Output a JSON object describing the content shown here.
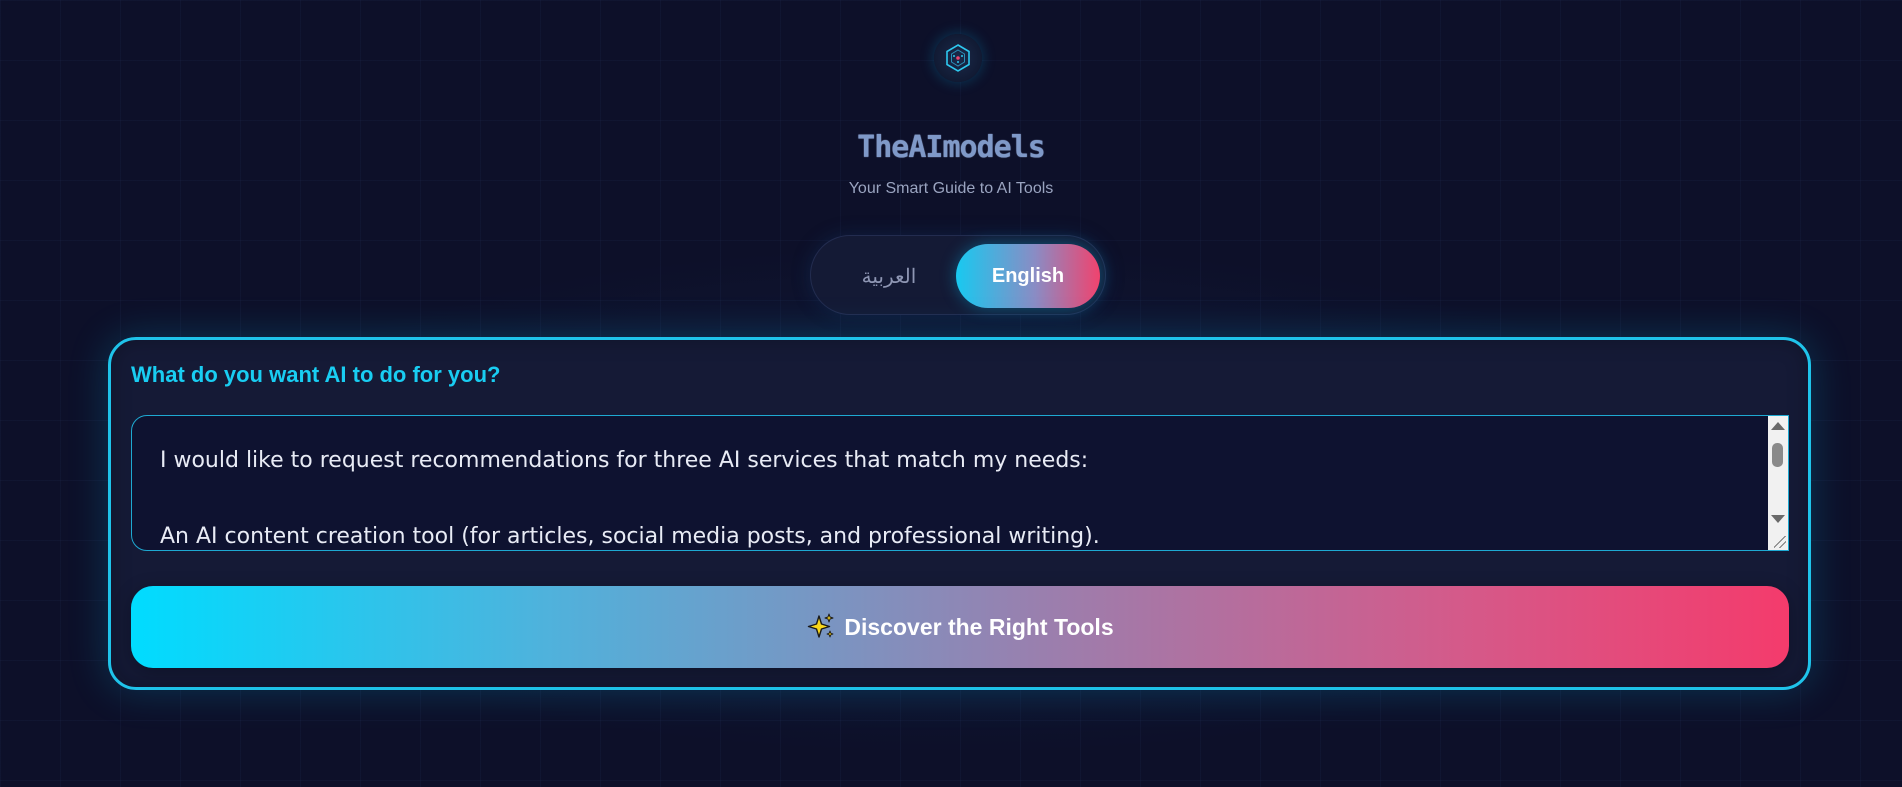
{
  "brand": {
    "title": "TheAImodels",
    "subtitle": "Your Smart Guide to AI Tools",
    "logo_icon": "hexagon-network-icon"
  },
  "language": {
    "arabic_label": "العربية",
    "english_label": "English",
    "selected": "English"
  },
  "prompt": {
    "label": "What do you want AI to do for you?",
    "value": "I would like to request recommendations for three AI services that match my needs:\n\nAn AI content creation tool (for articles, social media posts, and professional writing)."
  },
  "action": {
    "discover_label": "Discover the Right Tools",
    "icon": "sparkles-icon"
  },
  "colors": {
    "accent_cyan": "#1fc3ea",
    "accent_pink": "#f43b6c",
    "background": "#0d1029"
  }
}
